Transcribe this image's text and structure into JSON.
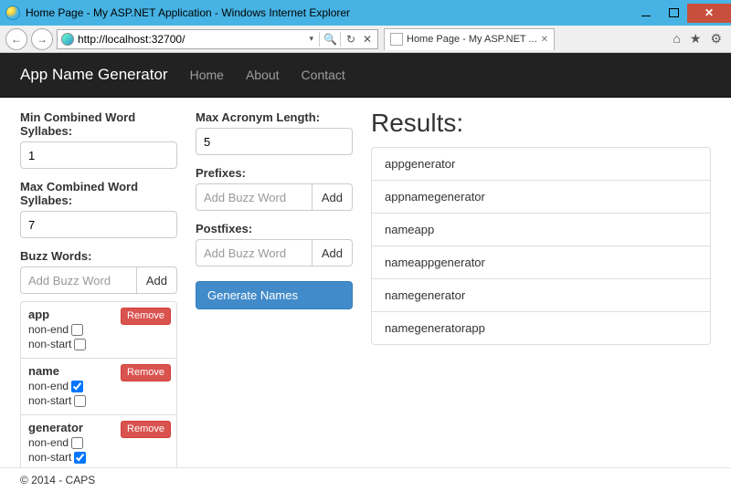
{
  "window": {
    "title": "Home Page - My ASP.NET Application - Windows Internet Explorer"
  },
  "browser": {
    "url": "http://localhost:32700/",
    "tab_label": "Home Page - My ASP.NET ..."
  },
  "navbar": {
    "brand": "App Name Generator",
    "links": {
      "home": "Home",
      "about": "About",
      "contact": "Contact"
    }
  },
  "form": {
    "min_syllables": {
      "label": "Min Combined Word Syllabes:",
      "value": "1"
    },
    "max_syllables": {
      "label": "Max Combined Word Syllabes:",
      "value": "7"
    },
    "buzz_words": {
      "label": "Buzz Words:",
      "placeholder": "Add Buzz Word",
      "add_label": "Add",
      "nonend_label": "non-end",
      "nonstart_label": "non-start",
      "remove_label": "Remove",
      "items": [
        {
          "word": "app",
          "non_end": false,
          "non_start": false
        },
        {
          "word": "name",
          "non_end": true,
          "non_start": false
        },
        {
          "word": "generator",
          "non_end": false,
          "non_start": true
        }
      ]
    },
    "max_acronym": {
      "label": "Max Acronym Length:",
      "value": "5"
    },
    "prefixes": {
      "label": "Prefixes:",
      "placeholder": "Add Buzz Word",
      "add_label": "Add"
    },
    "postfixes": {
      "label": "Postfixes:",
      "placeholder": "Add Buzz Word",
      "add_label": "Add"
    },
    "generate_label": "Generate Names"
  },
  "results": {
    "title": "Results:",
    "items": [
      "appgenerator",
      "appnamegenerator",
      "nameapp",
      "nameappgenerator",
      "namegenerator",
      "namegeneratorapp"
    ]
  },
  "footer": "© 2014 - CAPS"
}
